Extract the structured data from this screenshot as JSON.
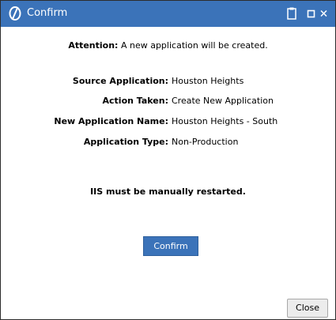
{
  "window": {
    "title": "Confirm",
    "logo_icon": "app-logo-icon",
    "controls": [
      "clipboard-icon",
      "maximize-icon",
      "close-icon"
    ],
    "accent_color": "#3b73b9"
  },
  "attention": {
    "label": "Attention:",
    "text": "A new application will be created."
  },
  "details": [
    {
      "label": "Source Application:",
      "value": "Houston Heights"
    },
    {
      "label": "Action Taken:",
      "value": "Create New Application"
    },
    {
      "label": "New Application Name:",
      "value": "Houston Heights - South"
    },
    {
      "label": "Application Type:",
      "value": "Non-Production"
    }
  ],
  "notice": "IIS must be manually restarted.",
  "buttons": {
    "confirm_label": "Confirm",
    "close_label": "Close"
  }
}
